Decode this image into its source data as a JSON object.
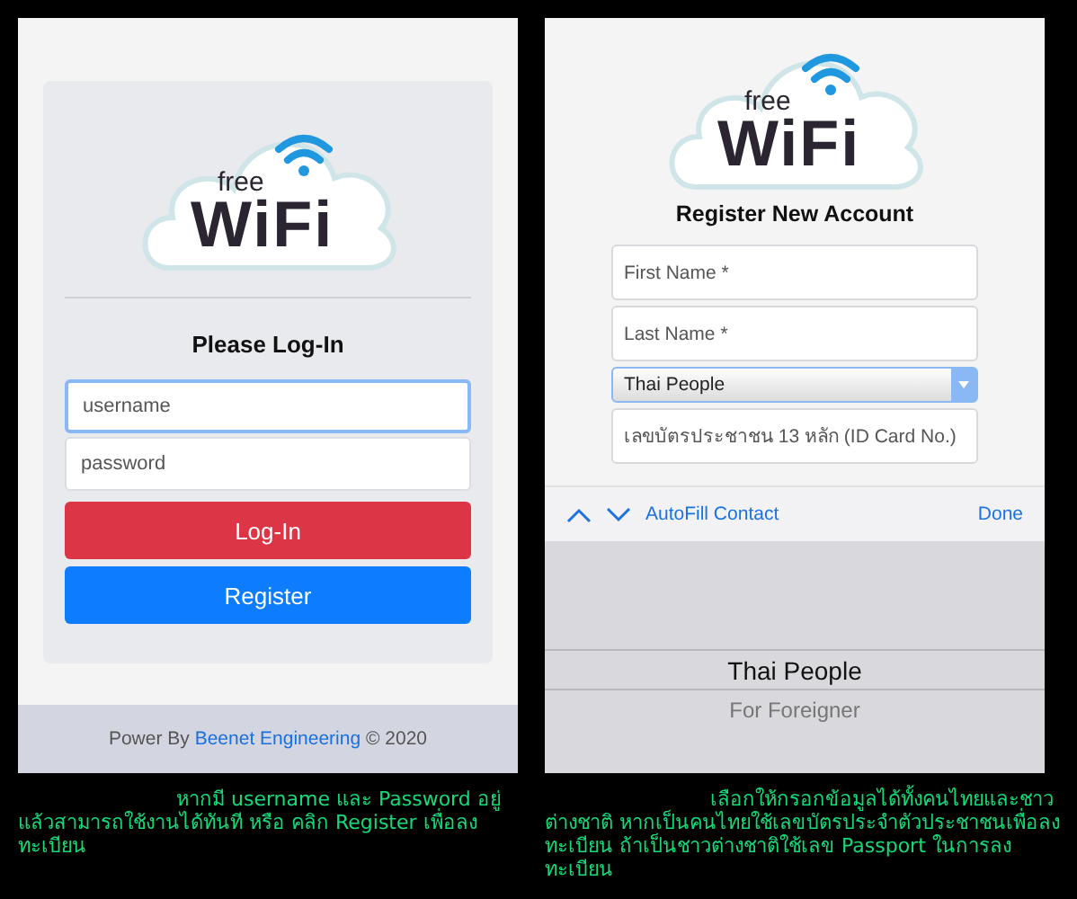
{
  "login_screen": {
    "logo": {
      "small": "free",
      "large": "WiFi"
    },
    "title": "Please Log-In",
    "fields": [
      {
        "placeholder": "username",
        "focused": true
      },
      {
        "placeholder": "password",
        "focused": false
      }
    ],
    "buttons": [
      {
        "label": "Log-In",
        "kind": "danger"
      },
      {
        "label": "Register",
        "kind": "primary"
      }
    ],
    "footer": {
      "prefix": "Power By",
      "link": "Beenet Engineering",
      "suffix": "© 2020"
    },
    "caption": "หากมี username และ Password อยู่แล้วสามารถใช้งานได้ทันที หรือ คลิก Register เพื่อลงทะเบียน"
  },
  "register_screen": {
    "logo": {
      "small": "free",
      "large": "WiFi"
    },
    "title": "Register New Account",
    "fields": [
      {
        "kind": "text",
        "placeholder": "First Name *"
      },
      {
        "kind": "text",
        "placeholder": "Last Name *"
      },
      {
        "kind": "select",
        "value": "Thai People"
      },
      {
        "kind": "text",
        "placeholder": "เลขบัตรประชาชน 13 หลัก (ID Card No.)"
      }
    ],
    "toolbar": {
      "autofill": "AutoFill Contact",
      "done": "Done"
    },
    "picker": [
      {
        "label": "Thai People",
        "selected": true
      },
      {
        "label": "For Foreigner",
        "selected": false
      }
    ],
    "caption": "เลือกให้กรอกข้อมูลได้ทั้งคนไทยและชาวต่างชาติ หากเป็นคนไทยใช้เลขบัตรประจำตัวประชาชนเพื่อลงทะเบียน ถ้าเป็นชาวต่างชาติใช้เลข Passport ในการลงทะเบียน"
  }
}
